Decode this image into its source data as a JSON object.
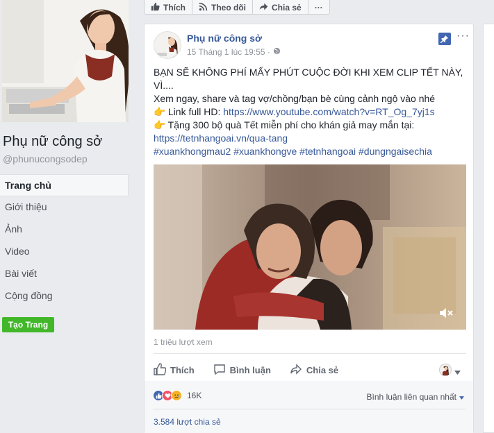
{
  "sidebar": {
    "page_name": "Phụ nữ công sở",
    "handle": "@phunucongsodep",
    "items": [
      {
        "label": "Trang chủ"
      },
      {
        "label": "Giới thiệu"
      },
      {
        "label": "Ảnh"
      },
      {
        "label": "Video"
      },
      {
        "label": "Bài viết"
      },
      {
        "label": "Cộng đồng"
      }
    ],
    "create_page_label": "Tạo Trang"
  },
  "topbar": {
    "like_label": "Thích",
    "follow_label": "Theo dõi",
    "share_label": "Chia sẻ",
    "more_label": "···"
  },
  "post": {
    "author": "Phụ nữ công sở",
    "timestamp": "15 Tháng 1 lúc 19:55 ·",
    "more_label": "···",
    "headline": "BẠN SẼ KHÔNG PHÍ MẤY PHÚT CUỘC ĐỜI KHI XEM CLIP TẾT NÀY, VÌ....",
    "line1": "Xem ngay, share và tag vợ/chồng/bạn bè cùng cảnh ngộ vào nhé",
    "link_label": " Link full HD: ",
    "link_url": "https://www.youtube.com/watch?v=RT_Og_7yj1s",
    "gift_label": " Tặng 300 bộ quà Tết miễn phí cho khán giả may mắn tại:",
    "gift_url": "https://tetnhangoai.vn/qua-tang",
    "hashtags": "#xuankhongmau2 #xuankhongve #tetnhangoai #dungngaisechia",
    "views": "1 triệu lượt xem",
    "actions": {
      "like": "Thích",
      "comment": "Bình luận",
      "share": "Chia sẻ"
    },
    "reaction_count": "16K",
    "sort_label": "Bình luận liên quan nhất",
    "shares": "3.584 lượt chia sẻ"
  },
  "colors": {
    "link_blue": "#365899",
    "brand_blue": "#4267b2",
    "green": "#42b72a",
    "love_red": "#f25268",
    "haha_yellow": "#f7b125"
  },
  "icons": [
    "like-thumb-icon",
    "rss-follow-icon",
    "share-arrow-icon",
    "pin-icon",
    "globe-icon",
    "pointing-hand-icon",
    "mute-icon",
    "comment-bubble-icon",
    "caret-down-icon",
    "like-reaction-icon",
    "love-reaction-icon",
    "sad-reaction-icon"
  ]
}
